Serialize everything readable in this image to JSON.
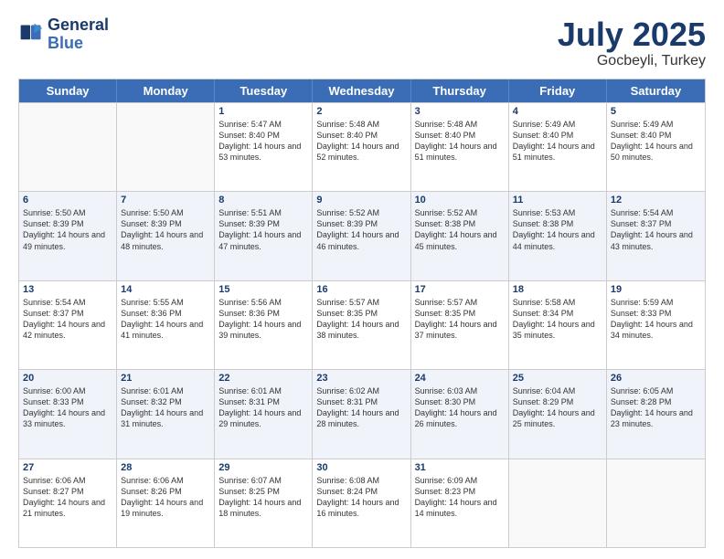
{
  "logo": {
    "line1": "General",
    "line2": "Blue"
  },
  "title": "July 2025",
  "location": "Gocbeyli, Turkey",
  "days_of_week": [
    "Sunday",
    "Monday",
    "Tuesday",
    "Wednesday",
    "Thursday",
    "Friday",
    "Saturday"
  ],
  "weeks": [
    [
      {
        "day": "",
        "info": ""
      },
      {
        "day": "",
        "info": ""
      },
      {
        "day": "1",
        "info": "Sunrise: 5:47 AM\nSunset: 8:40 PM\nDaylight: 14 hours and 53 minutes."
      },
      {
        "day": "2",
        "info": "Sunrise: 5:48 AM\nSunset: 8:40 PM\nDaylight: 14 hours and 52 minutes."
      },
      {
        "day": "3",
        "info": "Sunrise: 5:48 AM\nSunset: 8:40 PM\nDaylight: 14 hours and 51 minutes."
      },
      {
        "day": "4",
        "info": "Sunrise: 5:49 AM\nSunset: 8:40 PM\nDaylight: 14 hours and 51 minutes."
      },
      {
        "day": "5",
        "info": "Sunrise: 5:49 AM\nSunset: 8:40 PM\nDaylight: 14 hours and 50 minutes."
      }
    ],
    [
      {
        "day": "6",
        "info": "Sunrise: 5:50 AM\nSunset: 8:39 PM\nDaylight: 14 hours and 49 minutes."
      },
      {
        "day": "7",
        "info": "Sunrise: 5:50 AM\nSunset: 8:39 PM\nDaylight: 14 hours and 48 minutes."
      },
      {
        "day": "8",
        "info": "Sunrise: 5:51 AM\nSunset: 8:39 PM\nDaylight: 14 hours and 47 minutes."
      },
      {
        "day": "9",
        "info": "Sunrise: 5:52 AM\nSunset: 8:39 PM\nDaylight: 14 hours and 46 minutes."
      },
      {
        "day": "10",
        "info": "Sunrise: 5:52 AM\nSunset: 8:38 PM\nDaylight: 14 hours and 45 minutes."
      },
      {
        "day": "11",
        "info": "Sunrise: 5:53 AM\nSunset: 8:38 PM\nDaylight: 14 hours and 44 minutes."
      },
      {
        "day": "12",
        "info": "Sunrise: 5:54 AM\nSunset: 8:37 PM\nDaylight: 14 hours and 43 minutes."
      }
    ],
    [
      {
        "day": "13",
        "info": "Sunrise: 5:54 AM\nSunset: 8:37 PM\nDaylight: 14 hours and 42 minutes."
      },
      {
        "day": "14",
        "info": "Sunrise: 5:55 AM\nSunset: 8:36 PM\nDaylight: 14 hours and 41 minutes."
      },
      {
        "day": "15",
        "info": "Sunrise: 5:56 AM\nSunset: 8:36 PM\nDaylight: 14 hours and 39 minutes."
      },
      {
        "day": "16",
        "info": "Sunrise: 5:57 AM\nSunset: 8:35 PM\nDaylight: 14 hours and 38 minutes."
      },
      {
        "day": "17",
        "info": "Sunrise: 5:57 AM\nSunset: 8:35 PM\nDaylight: 14 hours and 37 minutes."
      },
      {
        "day": "18",
        "info": "Sunrise: 5:58 AM\nSunset: 8:34 PM\nDaylight: 14 hours and 35 minutes."
      },
      {
        "day": "19",
        "info": "Sunrise: 5:59 AM\nSunset: 8:33 PM\nDaylight: 14 hours and 34 minutes."
      }
    ],
    [
      {
        "day": "20",
        "info": "Sunrise: 6:00 AM\nSunset: 8:33 PM\nDaylight: 14 hours and 33 minutes."
      },
      {
        "day": "21",
        "info": "Sunrise: 6:01 AM\nSunset: 8:32 PM\nDaylight: 14 hours and 31 minutes."
      },
      {
        "day": "22",
        "info": "Sunrise: 6:01 AM\nSunset: 8:31 PM\nDaylight: 14 hours and 29 minutes."
      },
      {
        "day": "23",
        "info": "Sunrise: 6:02 AM\nSunset: 8:31 PM\nDaylight: 14 hours and 28 minutes."
      },
      {
        "day": "24",
        "info": "Sunrise: 6:03 AM\nSunset: 8:30 PM\nDaylight: 14 hours and 26 minutes."
      },
      {
        "day": "25",
        "info": "Sunrise: 6:04 AM\nSunset: 8:29 PM\nDaylight: 14 hours and 25 minutes."
      },
      {
        "day": "26",
        "info": "Sunrise: 6:05 AM\nSunset: 8:28 PM\nDaylight: 14 hours and 23 minutes."
      }
    ],
    [
      {
        "day": "27",
        "info": "Sunrise: 6:06 AM\nSunset: 8:27 PM\nDaylight: 14 hours and 21 minutes."
      },
      {
        "day": "28",
        "info": "Sunrise: 6:06 AM\nSunset: 8:26 PM\nDaylight: 14 hours and 19 minutes."
      },
      {
        "day": "29",
        "info": "Sunrise: 6:07 AM\nSunset: 8:25 PM\nDaylight: 14 hours and 18 minutes."
      },
      {
        "day": "30",
        "info": "Sunrise: 6:08 AM\nSunset: 8:24 PM\nDaylight: 14 hours and 16 minutes."
      },
      {
        "day": "31",
        "info": "Sunrise: 6:09 AM\nSunset: 8:23 PM\nDaylight: 14 hours and 14 minutes."
      },
      {
        "day": "",
        "info": ""
      },
      {
        "day": "",
        "info": ""
      }
    ]
  ]
}
